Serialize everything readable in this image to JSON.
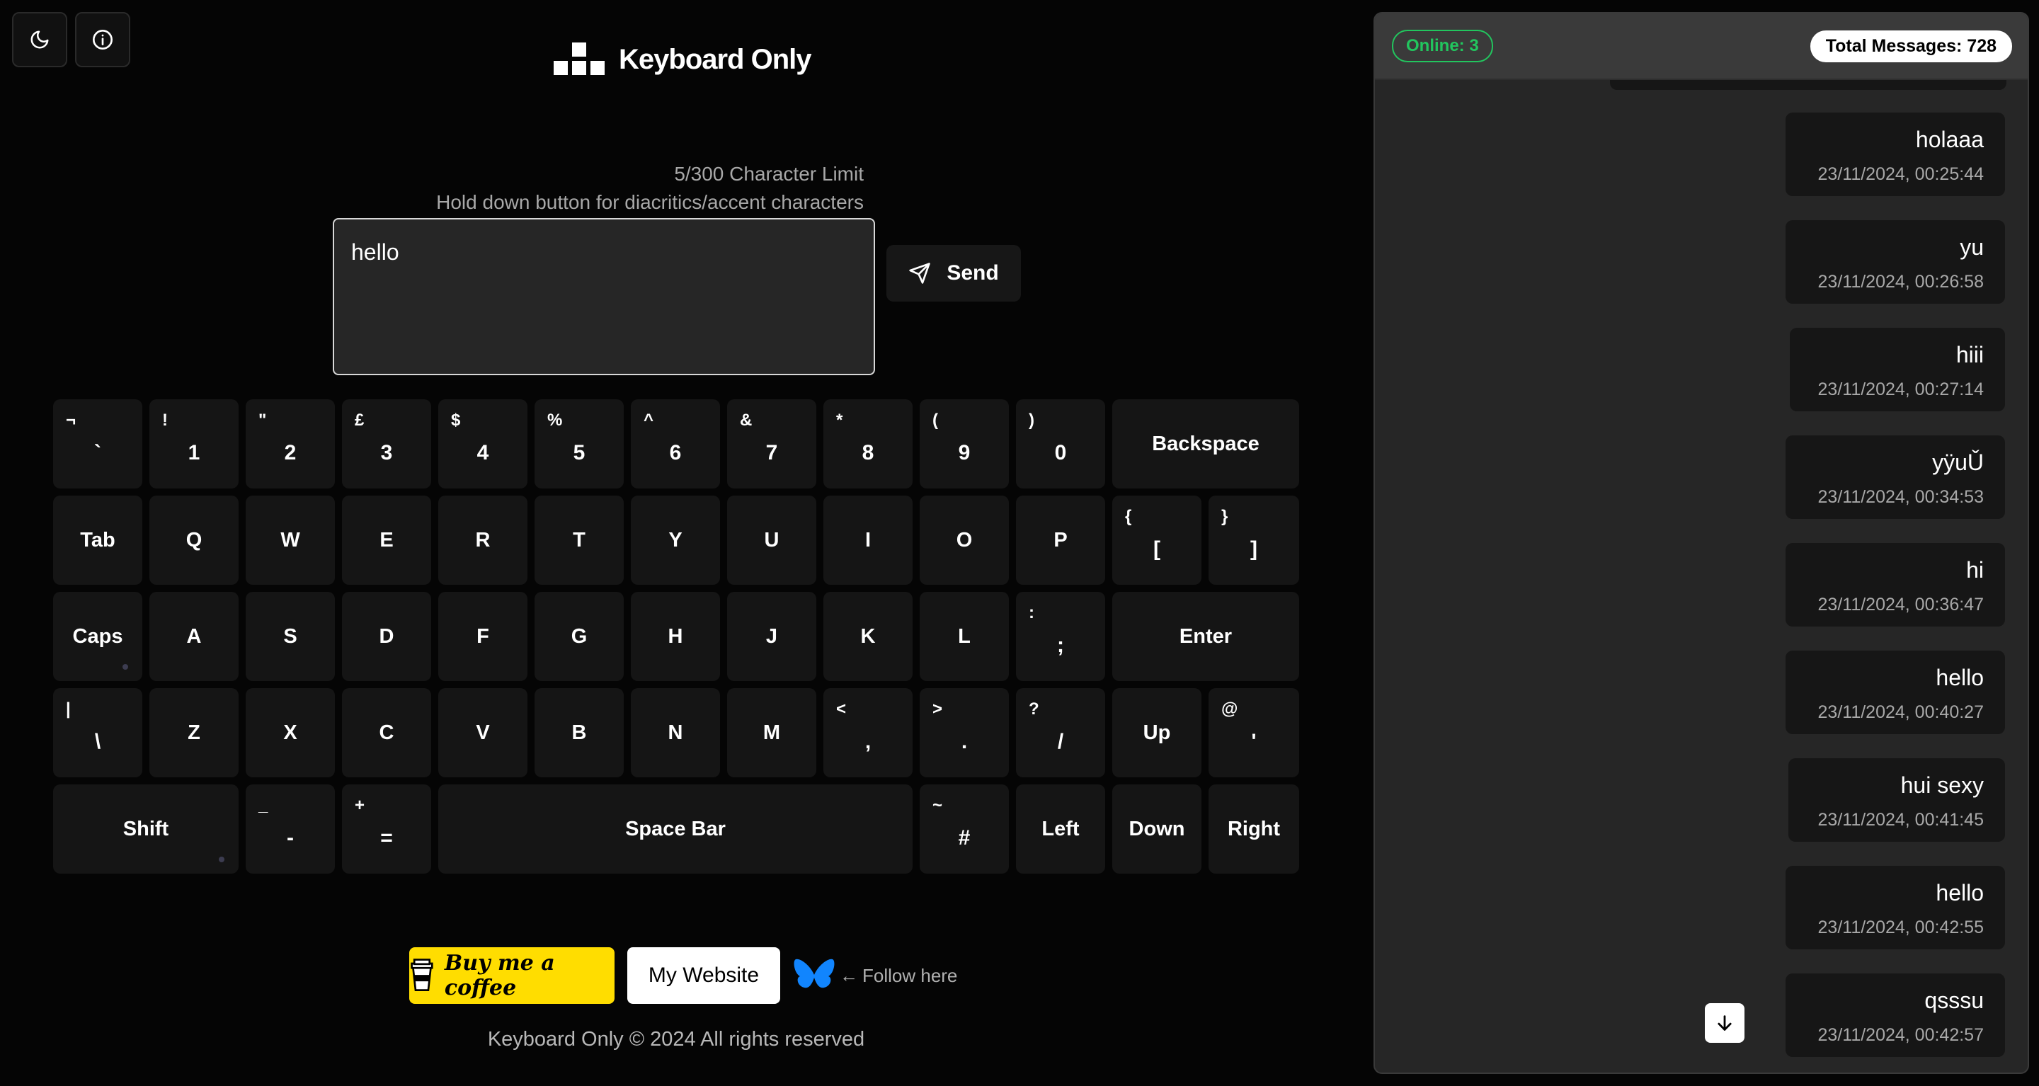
{
  "app": {
    "title": "Keyboard Only"
  },
  "top_buttons": [
    {
      "icon": "moon-icon"
    },
    {
      "icon": "info-icon"
    }
  ],
  "composer": {
    "char_limit": "5/300 Character Limit",
    "hint": "Hold down button for diacritics/accent characters",
    "value": "hello",
    "send_label": "Send"
  },
  "keyboard": {
    "rows": [
      [
        {
          "sec": "¬",
          "pri": "`"
        },
        {
          "sec": "!",
          "pri": "1"
        },
        {
          "sec": "\"",
          "pri": "2"
        },
        {
          "sec": "£",
          "pri": "3"
        },
        {
          "sec": "$",
          "pri": "4"
        },
        {
          "sec": "%",
          "pri": "5"
        },
        {
          "sec": "^",
          "pri": "6"
        },
        {
          "sec": "&",
          "pri": "7"
        },
        {
          "sec": "*",
          "pri": "8"
        },
        {
          "sec": "(",
          "pri": "9"
        },
        {
          "sec": ")",
          "pri": "0"
        },
        {
          "label": "Backspace"
        }
      ],
      [
        {
          "label": "Tab"
        },
        {
          "label": "Q"
        },
        {
          "label": "W"
        },
        {
          "label": "E"
        },
        {
          "label": "R"
        },
        {
          "label": "T"
        },
        {
          "label": "Y"
        },
        {
          "label": "U"
        },
        {
          "label": "I"
        },
        {
          "label": "O"
        },
        {
          "label": "P"
        },
        {
          "sec": "{",
          "pri": "["
        },
        {
          "sec": "}",
          "pri": "]"
        }
      ],
      [
        {
          "label": "Caps"
        },
        {
          "label": "A"
        },
        {
          "label": "S"
        },
        {
          "label": "D"
        },
        {
          "label": "F"
        },
        {
          "label": "G"
        },
        {
          "label": "H"
        },
        {
          "label": "J"
        },
        {
          "label": "K"
        },
        {
          "label": "L"
        },
        {
          "sec": ":",
          "pri": ";"
        },
        {
          "label": "Enter"
        }
      ],
      [
        {
          "sec": "|",
          "pri": "\\"
        },
        {
          "label": "Z"
        },
        {
          "label": "X"
        },
        {
          "label": "C"
        },
        {
          "label": "V"
        },
        {
          "label": "B"
        },
        {
          "label": "N"
        },
        {
          "label": "M"
        },
        {
          "sec": "<",
          "pri": ","
        },
        {
          "sec": ">",
          "pri": "."
        },
        {
          "sec": "?",
          "pri": "/"
        },
        {
          "label": "Up"
        },
        {
          "sec": "@",
          "pri": "'"
        }
      ],
      [
        {
          "label": "Shift"
        },
        {
          "sec": "_",
          "pri": "-"
        },
        {
          "sec": "+",
          "pri": "="
        },
        {
          "label": "Space Bar"
        },
        {
          "sec": "~",
          "pri": "#"
        },
        {
          "label": "Left"
        },
        {
          "label": "Down"
        },
        {
          "label": "Right"
        }
      ]
    ]
  },
  "footer": {
    "coffee_label": "Buy me a coffee",
    "website_label": "My Website",
    "follow_label": "Follow here",
    "copyright": "Keyboard Only © 2024 All rights reserved"
  },
  "chat": {
    "online": "Online: 3",
    "total": "Total Messages: 728",
    "messages": [
      {
        "text": "holaaa",
        "time": "23/11/2024, 00:25:44"
      },
      {
        "text": "yu",
        "time": "23/11/2024, 00:26:58"
      },
      {
        "text": "hiii",
        "time": "23/11/2024, 00:27:14"
      },
      {
        "text": "yÿuǓ",
        "time": "23/11/2024, 00:34:53"
      },
      {
        "text": "hi",
        "time": "23/11/2024, 00:36:47"
      },
      {
        "text": "hello",
        "time": "23/11/2024, 00:40:27"
      },
      {
        "text": "hui sexy",
        "time": "23/11/2024, 00:41:45"
      },
      {
        "text": "hello",
        "time": "23/11/2024, 00:42:55"
      },
      {
        "text": "qsssu",
        "time": "23/11/2024, 00:42:57"
      }
    ]
  },
  "colors": {
    "accent_online": "#22c55e",
    "coffee": "#ffdd00",
    "bluesky": "#1185fe"
  }
}
